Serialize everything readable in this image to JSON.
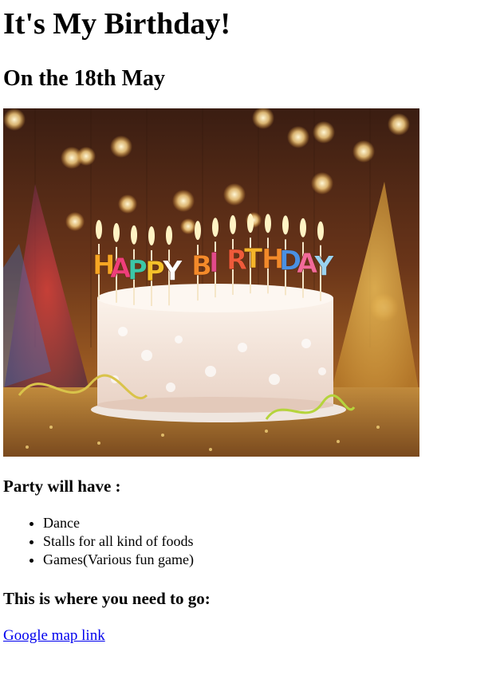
{
  "header": {
    "title": "It's My Birthday!",
    "date_heading": "On the 18th May"
  },
  "image": {
    "alt": "Birthday cake with HAPPY BIRTHDAY candles",
    "candle_letters": [
      "H",
      "A",
      "P",
      "P",
      "Y",
      " ",
      "B",
      "I",
      "R",
      "T",
      "H",
      "D",
      "A",
      "Y"
    ]
  },
  "party": {
    "heading": "Party will have :",
    "items": [
      "Dance",
      "Stalls for all kind of foods",
      "Games(Various fun game)"
    ]
  },
  "location": {
    "heading": "This is where you need to go:",
    "link_text": "Google map link"
  },
  "colors": {
    "link": "#0000ee",
    "text": "#000000"
  }
}
